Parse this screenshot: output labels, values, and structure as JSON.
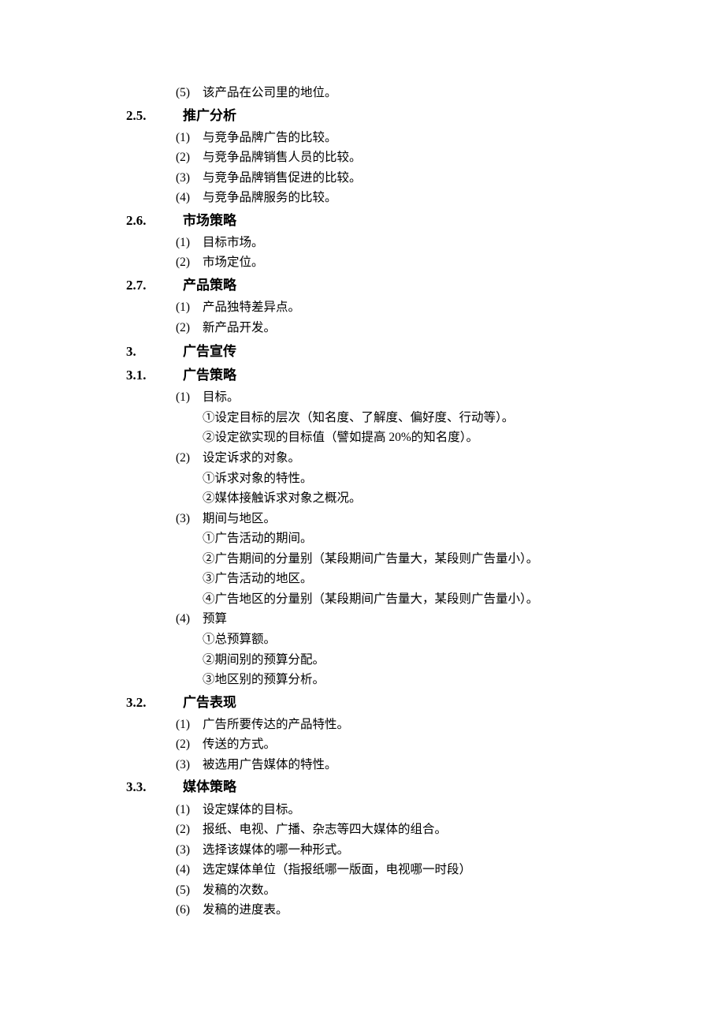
{
  "s24_5": {
    "n": "(5)",
    "t": "该产品在公司里的地位。"
  },
  "h25": {
    "n": "2.5.",
    "t": "推广分析"
  },
  "s25_1": {
    "n": "(1)",
    "t": "与竞争品牌广告的比较。"
  },
  "s25_2": {
    "n": "(2)",
    "t": "与竞争品牌销售人员的比较。"
  },
  "s25_3": {
    "n": "(3)",
    "t": "与竞争品牌销售促进的比较。"
  },
  "s25_4": {
    "n": "(4)",
    "t": "与竞争品牌服务的比较。"
  },
  "h26": {
    "n": "2.6.",
    "t": "市场策略"
  },
  "s26_1": {
    "n": "(1)",
    "t": "目标市场。"
  },
  "s26_2": {
    "n": "(2)",
    "t": "市场定位。"
  },
  "h27": {
    "n": "2.7.",
    "t": "产品策略"
  },
  "s27_1": {
    "n": "(1)",
    "t": "产品独特差异点。"
  },
  "s27_2": {
    "n": "(2)",
    "t": "新产品开发。"
  },
  "h3": {
    "n": "3.",
    "t": "广告宣传"
  },
  "h31": {
    "n": "3.1.",
    "t": "广告策略"
  },
  "s31_1": {
    "n": "(1)",
    "t": "目标。"
  },
  "s31_1a": {
    "t": "①设定目标的层次（知名度、了解度、偏好度、行动等）。"
  },
  "s31_1b": {
    "t": "②设定欲实现的目标值（譬如提高 20%的知名度）。"
  },
  "s31_2": {
    "n": "(2)",
    "t": "设定诉求的对象。"
  },
  "s31_2a": {
    "t": "①诉求对象的特性。"
  },
  "s31_2b": {
    "t": "②媒体接触诉求对象之概况。"
  },
  "s31_3": {
    "n": "(3)",
    "t": "期间与地区。"
  },
  "s31_3a": {
    "t": "①广告活动的期间。"
  },
  "s31_3b": {
    "t": "②广告期间的分量别（某段期间广告量大，某段则广告量小）。"
  },
  "s31_3c": {
    "t": "③广告活动的地区。"
  },
  "s31_3d": {
    "t": "④广告地区的分量别（某段期间广告量大，某段则广告量小）。"
  },
  "s31_4": {
    "n": "(4)",
    "t": "预算"
  },
  "s31_4a": {
    "t": "①总预算额。"
  },
  "s31_4b": {
    "t": "②期间别的预算分配。"
  },
  "s31_4c": {
    "t": "③地区别的预算分析。"
  },
  "h32": {
    "n": "3.2.",
    "t": "广告表现"
  },
  "s32_1": {
    "n": "(1)",
    "t": "广告所要传达的产品特性。"
  },
  "s32_2": {
    "n": "(2)",
    "t": "传送的方式。"
  },
  "s32_3": {
    "n": "(3)",
    "t": "被选用广告媒体的特性。"
  },
  "h33": {
    "n": "3.3.",
    "t": "媒体策略"
  },
  "s33_1": {
    "n": "(1)",
    "t": "设定媒体的目标。"
  },
  "s33_2": {
    "n": "(2)",
    "t": "报纸、电视、广播、杂志等四大媒体的组合。"
  },
  "s33_3": {
    "n": "(3)",
    "t": "选择该媒体的哪一种形式。"
  },
  "s33_4": {
    "n": "(4)",
    "t": "选定媒体单位（指报纸哪一版面，电视哪一时段）"
  },
  "s33_5": {
    "n": "(5)",
    "t": "发稿的次数。"
  },
  "s33_6": {
    "n": "(6)",
    "t": "发稿的进度表。"
  }
}
